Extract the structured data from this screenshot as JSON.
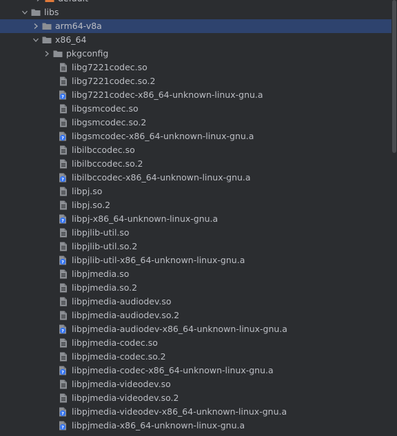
{
  "tree": {
    "top_partial": {
      "label": "default"
    },
    "libs": {
      "label": "libs"
    },
    "arm64": {
      "label": "arm64-v8a"
    },
    "x86": {
      "label": "x86_64"
    },
    "pkgconfig": {
      "label": "pkgconfig"
    },
    "files": [
      {
        "label": "libg7221codec.so",
        "kind": "so"
      },
      {
        "label": "libg7221codec.so.2",
        "kind": "so"
      },
      {
        "label": "libg7221codec-x86_64-unknown-linux-gnu.a",
        "kind": "a"
      },
      {
        "label": "libgsmcodec.so",
        "kind": "so"
      },
      {
        "label": "libgsmcodec.so.2",
        "kind": "so"
      },
      {
        "label": "libgsmcodec-x86_64-unknown-linux-gnu.a",
        "kind": "a"
      },
      {
        "label": "libilbccodec.so",
        "kind": "so"
      },
      {
        "label": "libilbccodec.so.2",
        "kind": "so"
      },
      {
        "label": "libilbccodec-x86_64-unknown-linux-gnu.a",
        "kind": "a"
      },
      {
        "label": "libpj.so",
        "kind": "so"
      },
      {
        "label": "libpj.so.2",
        "kind": "so"
      },
      {
        "label": "libpj-x86_64-unknown-linux-gnu.a",
        "kind": "a"
      },
      {
        "label": "libpjlib-util.so",
        "kind": "so"
      },
      {
        "label": "libpjlib-util.so.2",
        "kind": "so"
      },
      {
        "label": "libpjlib-util-x86_64-unknown-linux-gnu.a",
        "kind": "a"
      },
      {
        "label": "libpjmedia.so",
        "kind": "so"
      },
      {
        "label": "libpjmedia.so.2",
        "kind": "so"
      },
      {
        "label": "libpjmedia-audiodev.so",
        "kind": "so"
      },
      {
        "label": "libpjmedia-audiodev.so.2",
        "kind": "so"
      },
      {
        "label": "libpjmedia-audiodev-x86_64-unknown-linux-gnu.a",
        "kind": "a"
      },
      {
        "label": "libpjmedia-codec.so",
        "kind": "so"
      },
      {
        "label": "libpjmedia-codec.so.2",
        "kind": "so"
      },
      {
        "label": "libpjmedia-codec-x86_64-unknown-linux-gnu.a",
        "kind": "a"
      },
      {
        "label": "libpjmedia-videodev.so",
        "kind": "so"
      },
      {
        "label": "libpjmedia-videodev.so.2",
        "kind": "so"
      },
      {
        "label": "libpjmedia-videodev-x86_64-unknown-linux-gnu.a",
        "kind": "a"
      },
      {
        "label": "libpjmedia-x86_64-unknown-linux-gnu.a",
        "kind": "a"
      }
    ]
  },
  "colors": {
    "background": "#2b2d30",
    "selection": "#2e436e",
    "text": "#bcbec4",
    "folder": "#8c8f94",
    "file": "#8c8f94",
    "unknown_badge": "#3574f0"
  },
  "icons": {
    "expanded": "chevron-down-icon",
    "collapsed": "chevron-right-icon",
    "folder": "folder-icon",
    "so_file": "file-icon",
    "a_file": "unknown-file-icon"
  }
}
